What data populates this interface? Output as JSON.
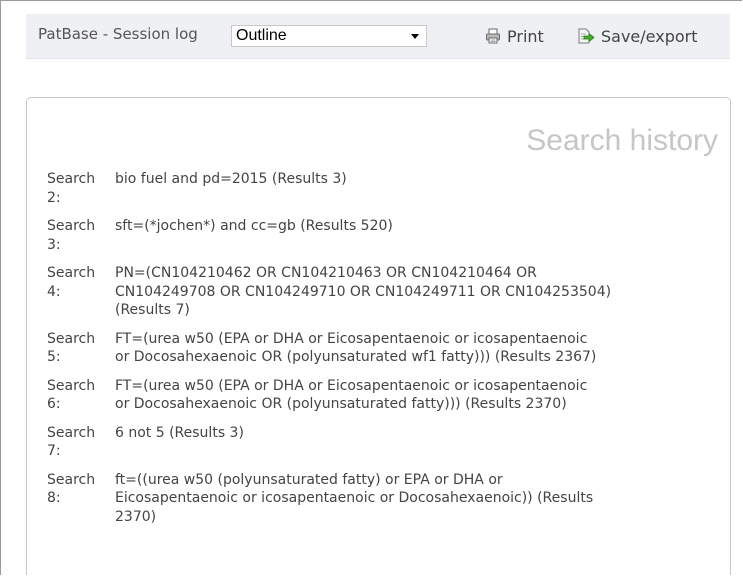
{
  "toolbar": {
    "title": "PatBase - Session log",
    "view_select_value": "Outline",
    "print_label": "Print",
    "save_export_label": "Save/export"
  },
  "panel": {
    "title": "Search history"
  },
  "history": [
    {
      "label": "Search",
      "number": "2:",
      "query": "bio fuel and pd=2015 (Results 3)"
    },
    {
      "label": "Search",
      "number": "3:",
      "query": "sft=(*jochen*) and cc=gb (Results 520)"
    },
    {
      "label": "Search",
      "number": "4:",
      "query": "PN=(CN104210462 OR CN104210463 OR CN104210464 OR\nCN104249708 OR CN104249710 OR CN104249711 OR CN104253504)\n(Results 7)"
    },
    {
      "label": "Search",
      "number": "5:",
      "query": "FT=(urea w50 (EPA or DHA or Eicosapentaenoic or icosapentaenoic\nor Docosahexaenoic OR (polyunsaturated wf1 fatty))) (Results 2367)"
    },
    {
      "label": "Search",
      "number": "6:",
      "query": "FT=(urea w50 (EPA or DHA or Eicosapentaenoic or icosapentaenoic\nor Docosahexaenoic OR (polyunsaturated fatty))) (Results 2370)"
    },
    {
      "label": "Search",
      "number": "7:",
      "query": "6 not 5 (Results 3)"
    },
    {
      "label": "Search",
      "number": "8:",
      "query": "ft=((urea w50 (polyunsaturated fatty) or EPA or DHA or\nEicosapentaenoic or icosapentaenoic or Docosahexaenoic)) (Results\n2370)"
    }
  ],
  "icons": {
    "print": "printer-icon",
    "save_export": "save-export-icon",
    "select": "chevron-down-icon"
  },
  "colors": {
    "toolbar_background": "#eef0f4",
    "panel_title": "#c6c6c6",
    "body_text": "#444444",
    "save_arrow": "#3fae2a"
  }
}
